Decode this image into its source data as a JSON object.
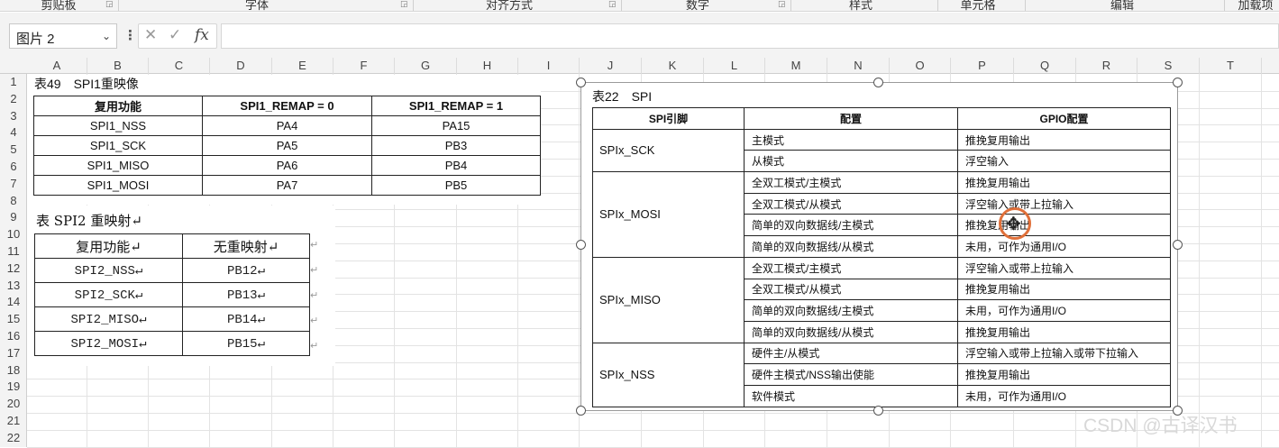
{
  "ribbon": {
    "groups": [
      "剪贴板",
      "字体",
      "对齐方式",
      "数字",
      "样式",
      "单元格",
      "编辑",
      "加载项"
    ]
  },
  "formula_bar": {
    "name_box": "图片 2",
    "fx": "fx",
    "value": ""
  },
  "columns": [
    "A",
    "B",
    "C",
    "D",
    "E",
    "F",
    "G",
    "H",
    "I",
    "J",
    "K",
    "L",
    "M",
    "N",
    "O",
    "P",
    "Q",
    "R",
    "S",
    "T"
  ],
  "rows": [
    "1",
    "2",
    "3",
    "4",
    "5",
    "6",
    "7",
    "8",
    "9",
    "10",
    "11",
    "12",
    "13",
    "14",
    "15",
    "16",
    "17",
    "18",
    "19",
    "20",
    "21",
    "22"
  ],
  "table1": {
    "title": "表49　SPI1重映像",
    "headers": [
      "复用功能",
      "SPI1_REMAP = 0",
      "SPI1_REMAP = 1"
    ],
    "rows": [
      [
        "SPI1_NSS",
        "PA4",
        "PA15"
      ],
      [
        "SPI1_SCK",
        "PA5",
        "PB3"
      ],
      [
        "SPI1_MISO",
        "PA6",
        "PB4"
      ],
      [
        "SPI1_MOSI",
        "PA7",
        "PB5"
      ]
    ]
  },
  "table2": {
    "title": "表 SPI2 重映射↵",
    "headers": [
      "复用功能↵",
      "无重映射↵"
    ],
    "rows": [
      [
        "SPI2_NSS↵",
        "PB12↵"
      ],
      [
        "SPI2_SCK↵",
        "PB13↵"
      ],
      [
        "SPI2_MISO↵",
        "PB14↵"
      ],
      [
        "SPI2_MOSI↵",
        "PB15↵"
      ]
    ],
    "ret": "↵"
  },
  "table3": {
    "title": "表22　SPI",
    "headers": [
      "SPI引脚",
      "配置",
      "GPIO配置"
    ],
    "groups": [
      {
        "pin": "SPIx_SCK",
        "rows": [
          [
            "主模式",
            "推挽复用输出"
          ],
          [
            "从模式",
            "浮空输入"
          ]
        ]
      },
      {
        "pin": "SPIx_MOSI",
        "rows": [
          [
            "全双工模式/主模式",
            "推挽复用输出"
          ],
          [
            "全双工模式/从模式",
            "浮空输入或带上拉输入"
          ],
          [
            "简单的双向数据线/主模式",
            "推挽复用输出"
          ],
          [
            "简单的双向数据线/从模式",
            "未用，可作为通用I/O"
          ]
        ]
      },
      {
        "pin": "SPIx_MISO",
        "rows": [
          [
            "全双工模式/主模式",
            "浮空输入或带上拉输入"
          ],
          [
            "全双工模式/从模式",
            "推挽复用输出"
          ],
          [
            "简单的双向数据线/主模式",
            "未用，可作为通用I/O"
          ],
          [
            "简单的双向数据线/从模式",
            "推挽复用输出"
          ]
        ]
      },
      {
        "pin": "SPIx_NSS",
        "rows": [
          [
            "硬件主/从模式",
            "浮空输入或带上拉输入或带下拉输入"
          ],
          [
            "硬件主模式/NSS输出使能",
            "推挽复用输出"
          ],
          [
            "软件模式",
            "未用，可作为通用I/O"
          ]
        ]
      }
    ]
  },
  "watermark": "CSDN @古译汉书"
}
